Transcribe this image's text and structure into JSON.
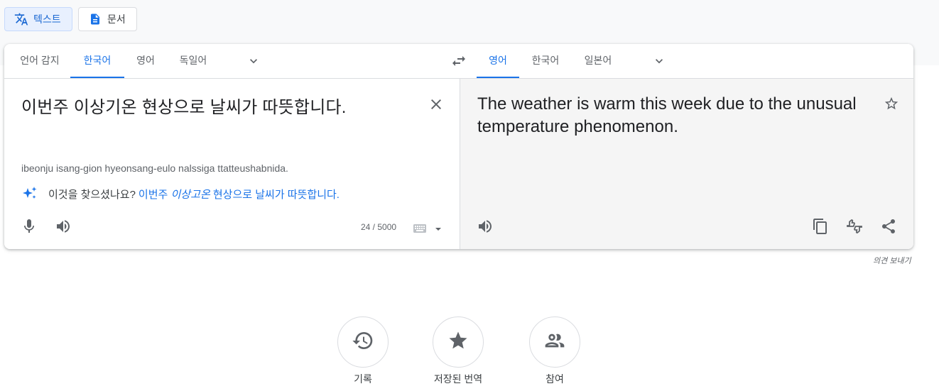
{
  "modes": {
    "text_label": "텍스트",
    "documents_label": "문서"
  },
  "source_langs": {
    "tabs": [
      "언어 감지",
      "한국어",
      "영어",
      "독일어"
    ],
    "active_index": 1
  },
  "target_langs": {
    "tabs": [
      "영어",
      "한국어",
      "일본어"
    ],
    "active_index": 0
  },
  "source": {
    "text": "이번주 이상기온 현상으로 날씨가 따뜻합니다.",
    "transliteration": "ibeonju isang-gion hyeonsang-eulo nalssiga ttatteushabnida.",
    "suggestion_prompt": "이것을 찾으셨나요?",
    "suggestion_part1": "이번주 ",
    "suggestion_italic": "이상고온",
    "suggestion_part2": " 현상으로 날씨가 따뜻합니다.",
    "char_count": "24 / 5000"
  },
  "target": {
    "text": "The weather is warm this week due to the unusual temperature phenomenon."
  },
  "feedback_label": "의견 보내기",
  "bottom_actions": {
    "history_label": "기록",
    "saved_label": "저장된 번역",
    "contribute_label": "참여"
  },
  "colors": {
    "accent": "#1a73e8",
    "icon": "#5f6368",
    "target_bg": "#f5f5f5"
  },
  "icons": [
    "translate-icon",
    "document-icon",
    "chevron-down-icon",
    "swap-icon",
    "close-icon",
    "sparkle-icon",
    "mic-icon",
    "speaker-icon",
    "keyboard-icon",
    "star-icon",
    "copy-icon",
    "rate-icon",
    "share-icon",
    "history-icon",
    "saved-star-icon",
    "people-icon"
  ]
}
